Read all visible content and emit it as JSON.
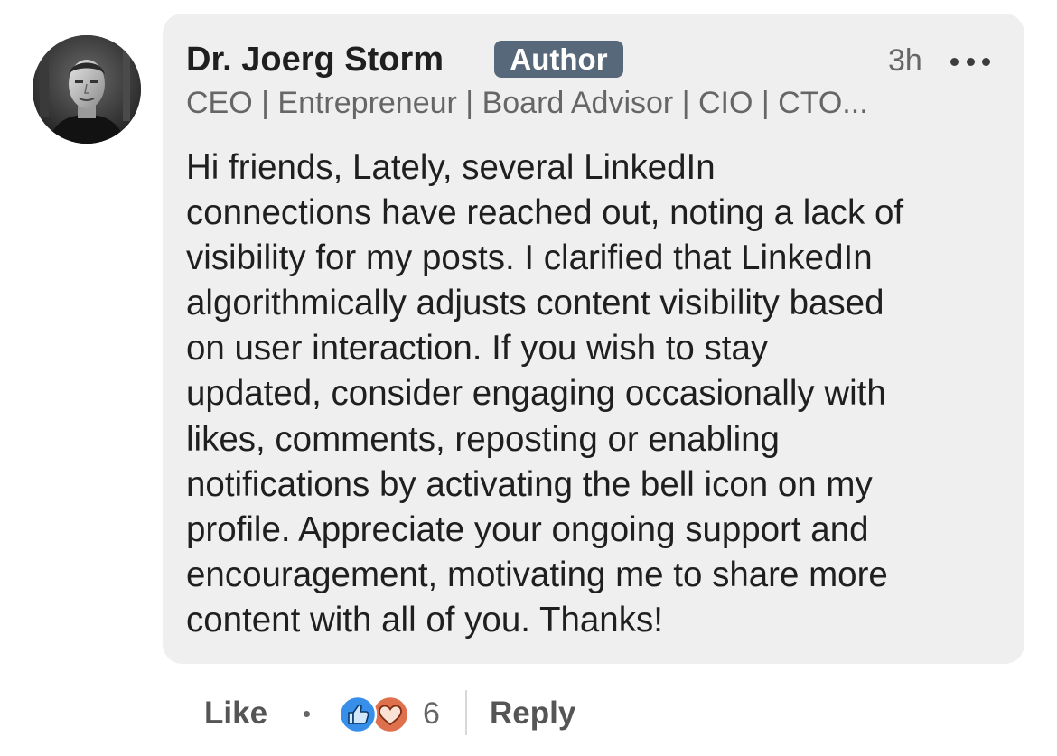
{
  "comment": {
    "author_name": "Dr. Joerg Storm",
    "badge": "Author",
    "timestamp": "3h",
    "headline": "CEO | Entrepreneur | Board Advisor | CIO | CTO...",
    "body_lines": [
      "Hi friends, Lately, several LinkedIn",
      "connections have reached out, noting a lack of",
      "visibility for my posts. I clarified that LinkedIn",
      "algorithmically adjusts content visibility based",
      "on user interaction. If you wish to stay",
      "updated, consider engaging occasionally with",
      "likes, comments, reposting or enabling",
      "notifications by activating the bell icon on my",
      "profile. Appreciate your ongoing support and",
      "encouragement, motivating me to share more",
      "content with all of you. Thanks!"
    ]
  },
  "actions": {
    "like_label": "Like",
    "reaction_count": "6",
    "reaction_icons": [
      "like-reaction-icon",
      "love-reaction-icon"
    ],
    "reply_label": "Reply"
  },
  "colors": {
    "bubble_bg": "#efefef",
    "badge_bg": "#56687a",
    "like_blue": "#378fe9",
    "love_red": "#df704d",
    "muted_text": "#666666"
  }
}
